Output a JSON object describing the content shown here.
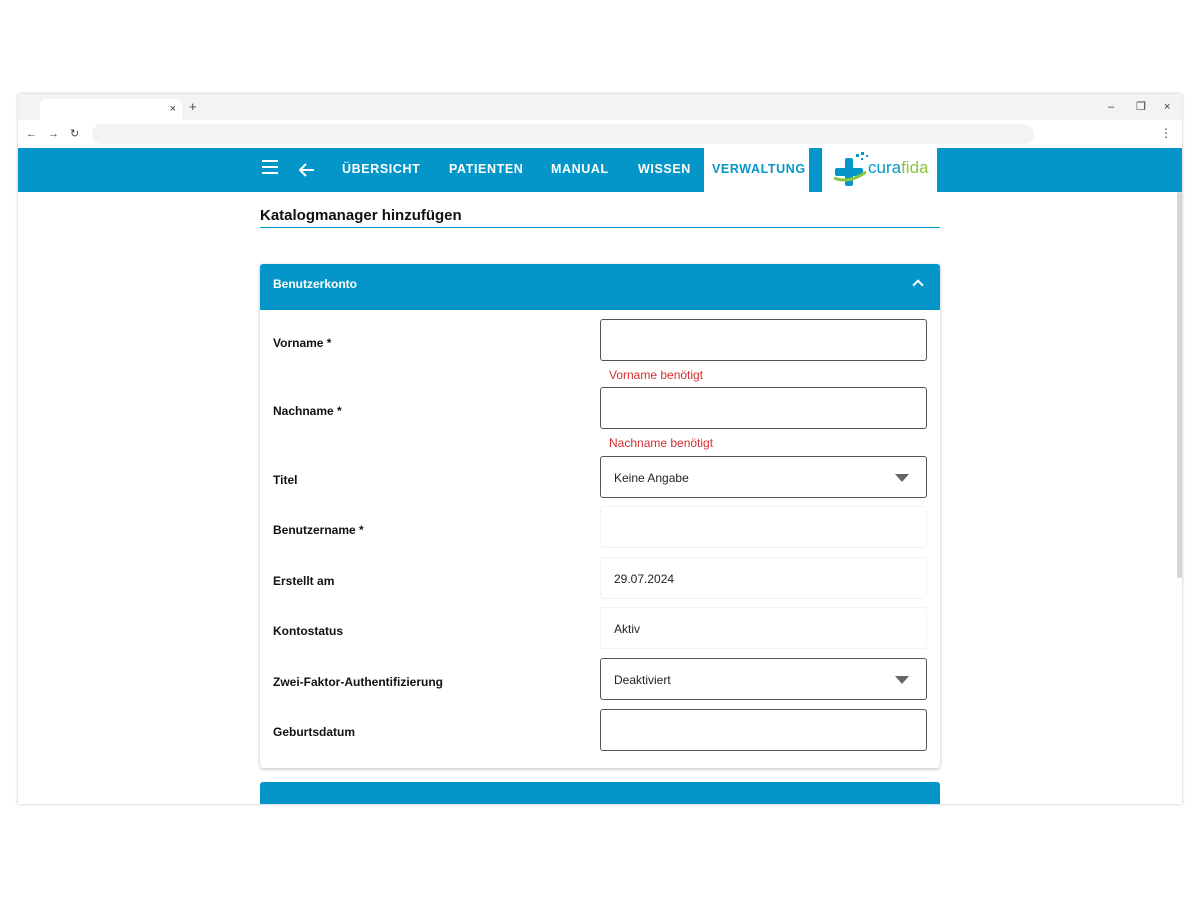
{
  "browser": {
    "tab_close": "×",
    "new_tab": "+",
    "win_min": "–",
    "win_restore": "❐",
    "win_close": "×",
    "nav_back": "←",
    "nav_forward": "→",
    "nav_reload": "↻",
    "menu": "⋮"
  },
  "header": {
    "back_glyph": "🡐",
    "nav": [
      "ÜBERSICHT",
      "PATIENTEN",
      "MANUAL",
      "WISSEN"
    ],
    "active": "VERWALTUNG",
    "logo_cura": "cura",
    "logo_fida": "fida",
    "brand_color": "#0496c9",
    "logo_green": "#8cc63f"
  },
  "page": {
    "title": "Katalogmanager hinzufügen"
  },
  "section": {
    "title": "Benutzerkonto"
  },
  "form": {
    "vorname": {
      "label": "Vorname *",
      "value": "",
      "error": "Vorname benötigt"
    },
    "nachname": {
      "label": "Nachname *",
      "value": "",
      "error": "Nachname benötigt"
    },
    "titel": {
      "label": "Titel",
      "value": "Keine Angabe"
    },
    "benutzername": {
      "label": "Benutzername *",
      "value": ""
    },
    "erstellt": {
      "label": "Erstellt am",
      "value": "29.07.2024"
    },
    "kontostatus": {
      "label": "Kontostatus",
      "value": "Aktiv"
    },
    "zwei_faktor": {
      "label": "Zwei-Faktor-Authentifizierung",
      "value": "Deaktiviert"
    },
    "geburtsdatum": {
      "label": "Geburtsdatum",
      "value": ""
    }
  },
  "error_color": "#d32f2f"
}
